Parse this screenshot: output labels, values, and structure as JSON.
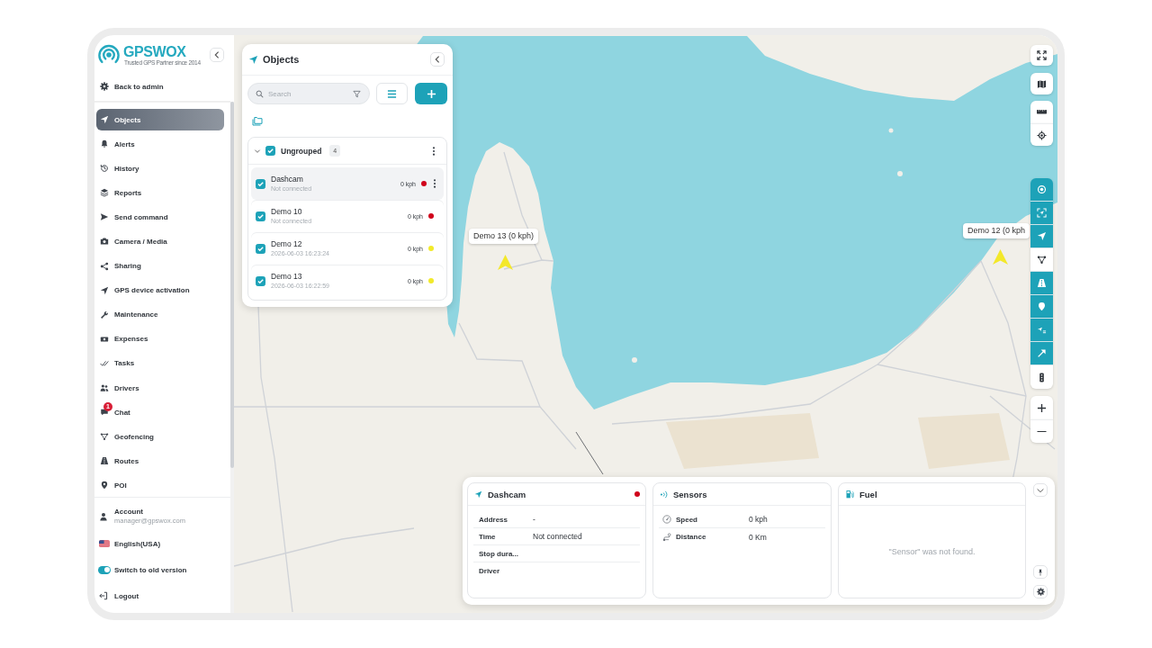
{
  "sidebar": {
    "logo_text": "GPSWOX",
    "tagline": "Trusted GPS Partner since 2014",
    "back_link": "Back to admin",
    "menu": [
      {
        "label": "Objects",
        "selected": true
      },
      {
        "label": "Alerts",
        "selected": false
      },
      {
        "label": "History",
        "selected": false
      },
      {
        "label": "Reports",
        "selected": false
      },
      {
        "label": "Send command",
        "selected": false
      },
      {
        "label": "Camera / Media",
        "selected": false
      },
      {
        "label": "Sharing",
        "selected": false
      },
      {
        "label": "GPS device activation",
        "selected": false
      },
      {
        "label": "Maintenance",
        "selected": false
      },
      {
        "label": "Expenses",
        "selected": false
      },
      {
        "label": "Tasks",
        "selected": false
      },
      {
        "label": "Drivers",
        "selected": false
      },
      {
        "label": "Chat",
        "selected": false,
        "badge": "1"
      },
      {
        "label": "Geofencing",
        "selected": false
      },
      {
        "label": "Routes",
        "selected": false
      },
      {
        "label": "POI",
        "selected": false
      }
    ],
    "account": {
      "label": "Account",
      "email": "manager@gpswox.com"
    },
    "language": "English(USA)",
    "old_version_switch": {
      "label": "Switch to old version",
      "on": true
    },
    "logout": "Logout"
  },
  "objects_panel": {
    "title": "Objects",
    "search": {
      "placeholder": "Search"
    },
    "groups": [
      {
        "name": "Ungrouped",
        "count": "4",
        "checked": true,
        "expanded": true,
        "items": [
          {
            "name": "Dashcam",
            "status": "Not connected",
            "speed": "0 kph",
            "color": "#d0021b",
            "checked": true,
            "selected": true
          },
          {
            "name": "Demo 10",
            "status": "Not connected",
            "speed": "0 kph",
            "color": "#d0021b",
            "checked": true,
            "selected": false
          },
          {
            "name": "Demo 12",
            "status": "2026-06-03 16:23:24",
            "speed": "0 kph",
            "color": "#f2ea2a",
            "checked": true,
            "selected": false
          },
          {
            "name": "Demo 13",
            "status": "2026-06-03 16:22:59",
            "speed": "0 kph",
            "color": "#f2ea2a",
            "checked": true,
            "selected": false
          }
        ]
      }
    ]
  },
  "map": {
    "markers": [
      {
        "label": "Demo 13 (0 kph)"
      },
      {
        "label": "Demo 12 (0 kph"
      }
    ],
    "tools": [
      {
        "on": true
      },
      {
        "on": true
      },
      {
        "on": true
      },
      {
        "on": false
      },
      {
        "on": true
      },
      {
        "on": true
      },
      {
        "on": true
      },
      {
        "on": true
      },
      {
        "on": false
      }
    ]
  },
  "details": {
    "object_card": {
      "title": "Dashcam",
      "color": "#d0021b",
      "rows": [
        {
          "label": "Address",
          "value": "-"
        },
        {
          "label": "Time",
          "value": "Not connected"
        },
        {
          "label": "Stop dura..."
        },
        {
          "label": "Driver"
        }
      ]
    },
    "sensors_card": {
      "title": "Sensors",
      "rows": [
        {
          "label": "Speed",
          "value": "0 kph"
        },
        {
          "label": "Distance",
          "value": "0 Km"
        }
      ]
    },
    "fuel_card": {
      "title": "Fuel",
      "message": "\"Sensor\" was not found."
    }
  }
}
